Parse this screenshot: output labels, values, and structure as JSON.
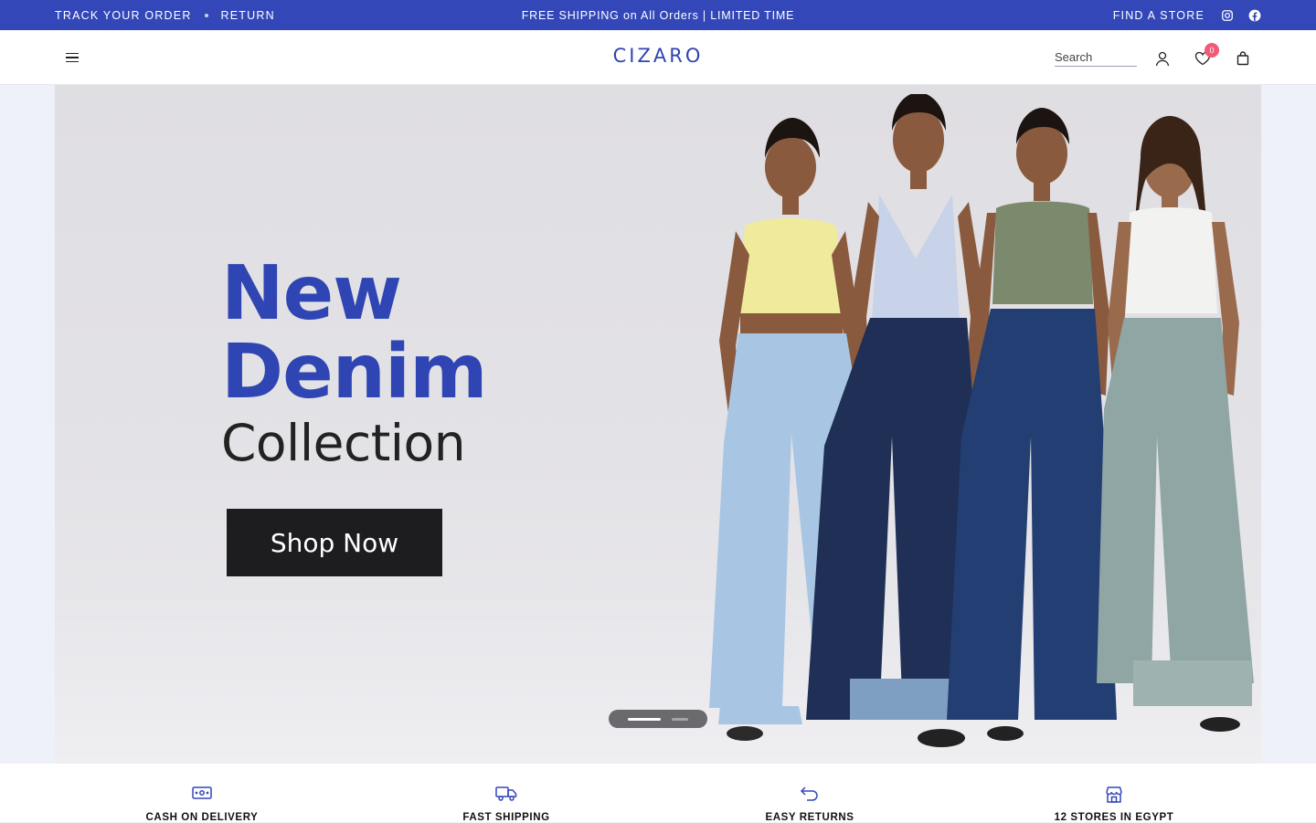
{
  "topbar": {
    "track_order": "TRACK YOUR ORDER",
    "return": "RETURN",
    "promo": "FREE SHIPPING on All Orders | LIMITED TIME",
    "find_store": "FIND A STORE",
    "social": [
      "instagram-icon",
      "facebook-icon"
    ]
  },
  "header": {
    "logo": "CIZARO",
    "search_placeholder": "Search",
    "wishlist_count": "0",
    "icons": [
      "menu-icon",
      "account-icon",
      "heart-icon",
      "bag-icon"
    ]
  },
  "hero": {
    "line1": "New",
    "line2": "Denim",
    "line3": "Collection",
    "cta": "Shop Now",
    "slides": 2,
    "active_slide": 1
  },
  "features": [
    {
      "label": "CASH ON DELIVERY",
      "icon": "cash-icon"
    },
    {
      "label": "FAST SHIPPING",
      "icon": "truck-icon"
    },
    {
      "label": "EASY RETURNS",
      "icon": "return-arrow-icon"
    },
    {
      "label": "12 STORES IN EGYPT",
      "icon": "store-icon"
    }
  ],
  "colors": {
    "brand": "#3347b8",
    "badge": "#f25a77",
    "cta_bg": "#1d1d1f"
  }
}
